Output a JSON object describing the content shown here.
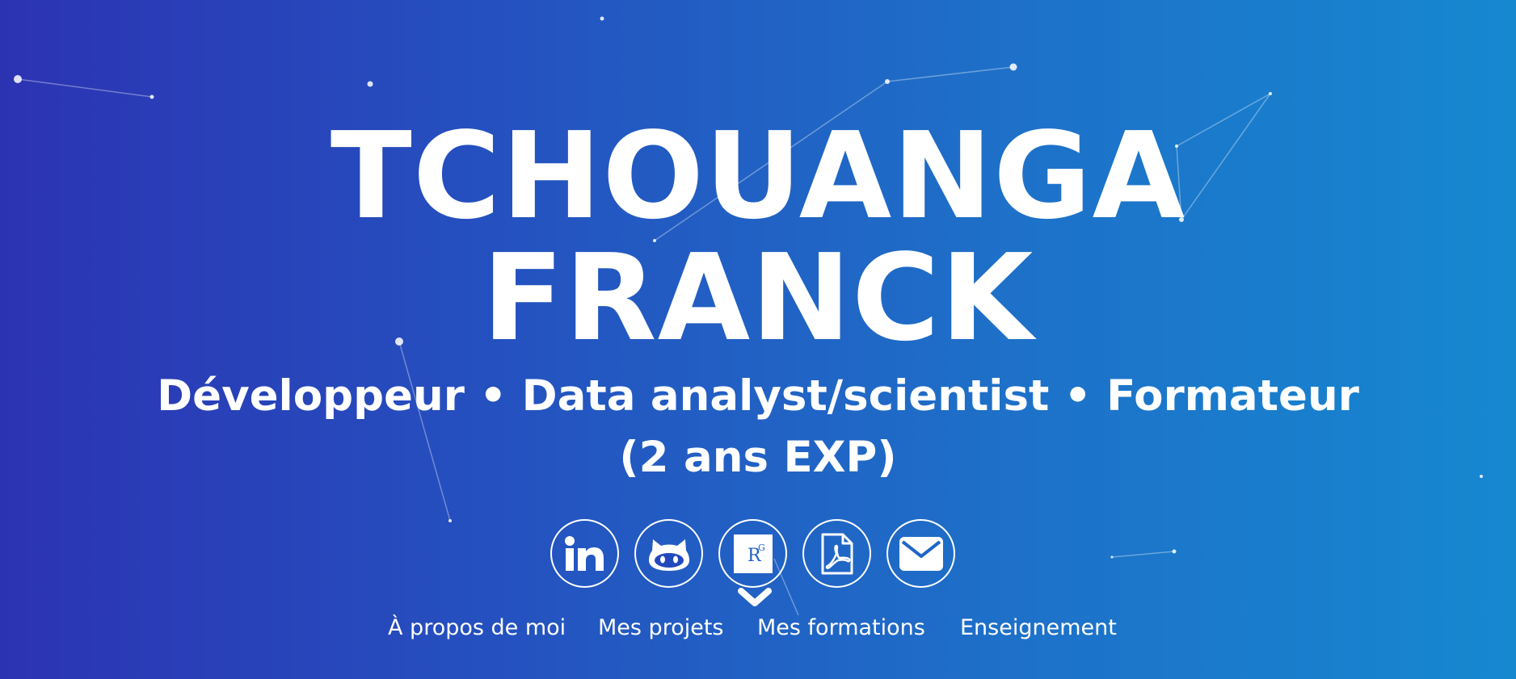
{
  "hero": {
    "name_line1": "TCHOUANGA",
    "name_line2": "FRANCK",
    "subtitle_line1": "Développeur • Data analyst/scientist • Formateur",
    "subtitle_line2": "(2 ans EXP)"
  },
  "socials": [
    {
      "icon": "linkedin-icon",
      "label": "in"
    },
    {
      "icon": "github-icon"
    },
    {
      "icon": "researchgate-icon",
      "label": "RG"
    },
    {
      "icon": "pdf-icon"
    },
    {
      "icon": "mail-icon"
    }
  ],
  "nav": {
    "about": "À propos de moi",
    "projects": "Mes projets",
    "education": "Mes formations",
    "teaching": "Enseignement"
  },
  "colors": {
    "gradient_start": "#2c33b3",
    "gradient_end": "#1688d0",
    "foreground": "#ffffff"
  }
}
